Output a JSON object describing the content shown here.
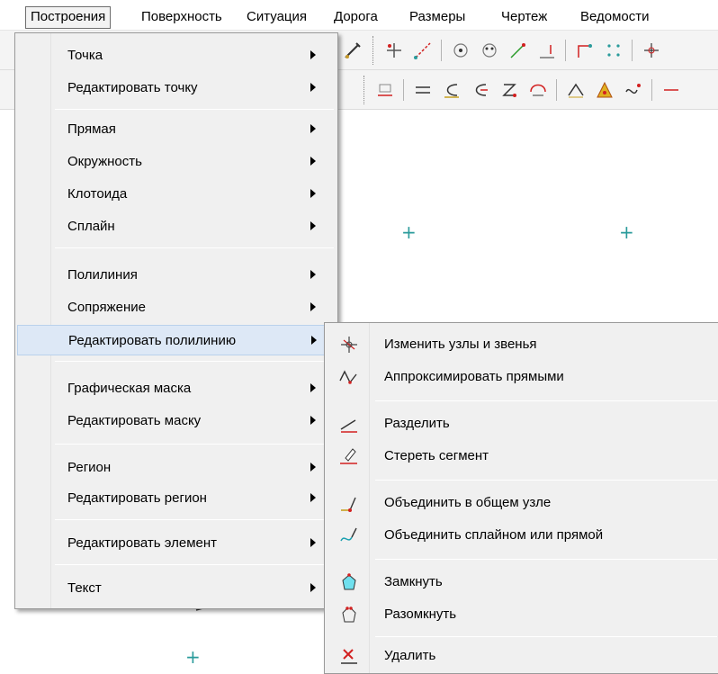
{
  "menubar": {
    "items": [
      {
        "label": "Построения"
      },
      {
        "label": "Поверхность"
      },
      {
        "label": "Ситуация"
      },
      {
        "label": "Дорога"
      },
      {
        "label": "Размеры"
      },
      {
        "label": "Чертеж"
      },
      {
        "label": "Ведомости"
      }
    ]
  },
  "main_menu": {
    "items": [
      {
        "label": "Точка",
        "has_submenu": true
      },
      {
        "label": "Редактировать точку",
        "has_submenu": true
      },
      {
        "label": "Прямая",
        "has_submenu": true
      },
      {
        "label": "Окружность",
        "has_submenu": true
      },
      {
        "label": "Клотоида",
        "has_submenu": true
      },
      {
        "label": "Сплайн",
        "has_submenu": true
      },
      {
        "label": "Полилиния",
        "has_submenu": true
      },
      {
        "label": "Сопряжение",
        "has_submenu": true
      },
      {
        "label": "Редактировать полилинию",
        "has_submenu": true,
        "highlighted": true
      },
      {
        "label": "Графическая маска",
        "has_submenu": true
      },
      {
        "label": "Редактировать маску",
        "has_submenu": true
      },
      {
        "label": "Регион",
        "has_submenu": true
      },
      {
        "label": "Редактировать регион",
        "has_submenu": true
      },
      {
        "label": "Редактировать элемент",
        "has_submenu": true
      },
      {
        "label": "Текст",
        "has_submenu": true
      }
    ]
  },
  "sub_menu": {
    "items": [
      {
        "label": "Изменить узлы и звенья",
        "icon": "edit-nodes-icon"
      },
      {
        "label": "Аппроксимировать прямыми",
        "icon": "approximate-lines-icon"
      },
      {
        "label": "Разделить",
        "icon": "split-icon"
      },
      {
        "label": "Стереть сегмент",
        "icon": "erase-segment-icon"
      },
      {
        "label": "Объединить в общем узле",
        "icon": "join-node-icon"
      },
      {
        "label": "Объединить сплайном или прямой",
        "icon": "join-spline-icon"
      },
      {
        "label": "Замкнуть",
        "icon": "close-polyline-icon"
      },
      {
        "label": "Разомкнуть",
        "icon": "open-polyline-icon"
      },
      {
        "label": "Удалить",
        "icon": "delete-icon"
      }
    ]
  },
  "colors": {
    "highlight": "#dde8f6",
    "menu_bg": "#f0f0f0",
    "cross": "#2a9b9b",
    "accent_red": "#d22020",
    "accent_teal": "#1aa0b0"
  }
}
